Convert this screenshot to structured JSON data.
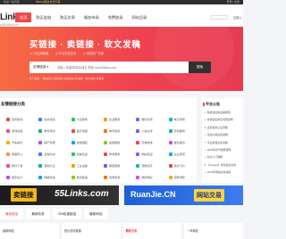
{
  "topbar": {
    "left": "欢迎一站可靠",
    "highlight": "55links安全方式下载",
    "right": "登录 | 注册"
  },
  "header": {
    "logo": "Links",
    "logo_sub": "友情链接交易平台",
    "nav": [
      "首页",
      "购买友链",
      "购买文章",
      "服务市场",
      "免费收录",
      "网站目录"
    ],
    "user_link": "注册入"
  },
  "hero": {
    "title": "买链接 · 卖链接 · 软文发稿",
    "features": [
      "◎ 7天全网覆盖",
      "◎ 平台担保交易",
      "◎ 海量推广资源"
    ],
    "search": {
      "type": "友情链接",
      "placeholder": "请输入关键词/网站/域名 例如 www.55links.com",
      "button": "搜索"
    },
    "hot": "热门搜索：  网站优化   百度权重   友情链接   外链推广   软文发布   新闻源"
  },
  "categories": {
    "title": "友情链接分类",
    "items": [
      {
        "label": "资讯新闻",
        "color": "#f0474b"
      },
      {
        "label": "站长综合",
        "color": "#3b82f6"
      },
      {
        "label": "IT互联网",
        "color": "#22c55e"
      },
      {
        "label": "生活服务",
        "color": "#f59e0b"
      },
      {
        "label": "娱乐影视",
        "color": "#8b5cf6"
      },
      {
        "label": "电子商务",
        "color": "#06b6d4"
      },
      {
        "label": "游戏动漫",
        "color": "#ec4899"
      },
      {
        "label": "教育培训",
        "color": "#10b981"
      },
      {
        "label": "医疗健康",
        "color": "#ef4444"
      },
      {
        "label": "体育健身",
        "color": "#f97316"
      },
      {
        "label": "小说文学",
        "color": "#6366f1"
      },
      {
        "label": "手机数码",
        "color": "#14b8a6"
      },
      {
        "label": "汽车摩托",
        "color": "#eab308"
      },
      {
        "label": "房产家居",
        "color": "#a855f7"
      },
      {
        "label": "旅游酒店",
        "color": "#0ea5e9"
      },
      {
        "label": "金融理财",
        "color": "#84cc16"
      },
      {
        "label": "农林牧渔",
        "color": "#f43f5e"
      },
      {
        "label": "餐饮美食",
        "color": "#d946ef"
      },
      {
        "label": "母婴育儿",
        "color": "#fb923c"
      },
      {
        "label": "女性时尚",
        "color": "#3b82f6"
      },
      {
        "label": "机械五金",
        "color": "#22c55e"
      },
      {
        "label": "商务服务",
        "color": "#f0474b"
      },
      {
        "label": "网站建设",
        "color": "#8b5cf6"
      },
      {
        "label": "企业黄页",
        "color": "#06b6d4"
      },
      {
        "label": "软件下载",
        "color": "#ec4899"
      },
      {
        "label": "其他行业",
        "color": "#10b981"
      },
      {
        "label": "工业设备",
        "color": "#f59e0b"
      },
      {
        "label": "服装鞋帽",
        "color": "#6366f1"
      },
      {
        "label": "宠物花卉",
        "color": "#14b8a6"
      },
      {
        "label": "地方门户",
        "color": "#ef4444"
      },
      {
        "label": "摄影设计",
        "color": "#a855f7"
      },
      {
        "label": "网络科技",
        "color": "#0ea5e9"
      },
      {
        "label": "物流快递",
        "color": "#84cc16"
      },
      {
        "label": "法律咨询",
        "color": "#f97316"
      },
      {
        "label": "婚庆婚纱",
        "color": "#d946ef"
      },
      {
        "label": "招聘求职",
        "color": "#eab308"
      }
    ]
  },
  "sidebar": {
    "title": "平台公告",
    "items": [
      "购买链接前必看规则",
      "友情链接常见问题说明",
      "卖家资质认证流程",
      "链接价格设置说明",
      "平台担保交易流程",
      "2022年春节放假通知",
      "新手入门教程",
      "【Google】友情链接交易",
      "2024年网站交易指南"
    ]
  },
  "banners": {
    "left_tag": "卖链接",
    "left_domain": "55Links.com",
    "right_domain": "RuanJie.CN",
    "right_tag": "网站交易"
  },
  "tabs": [
    "最新链接",
    "最新收录",
    "300权重链接",
    "最新网站"
  ],
  "bottom": [
    {
      "label": "最新网站",
      "red": false
    },
    {
      "label": "低价友情链接",
      "red": false
    },
    {
      "label": "最新交易",
      "red": true
    },
    {
      "label": "一年网站",
      "red": false
    }
  ]
}
